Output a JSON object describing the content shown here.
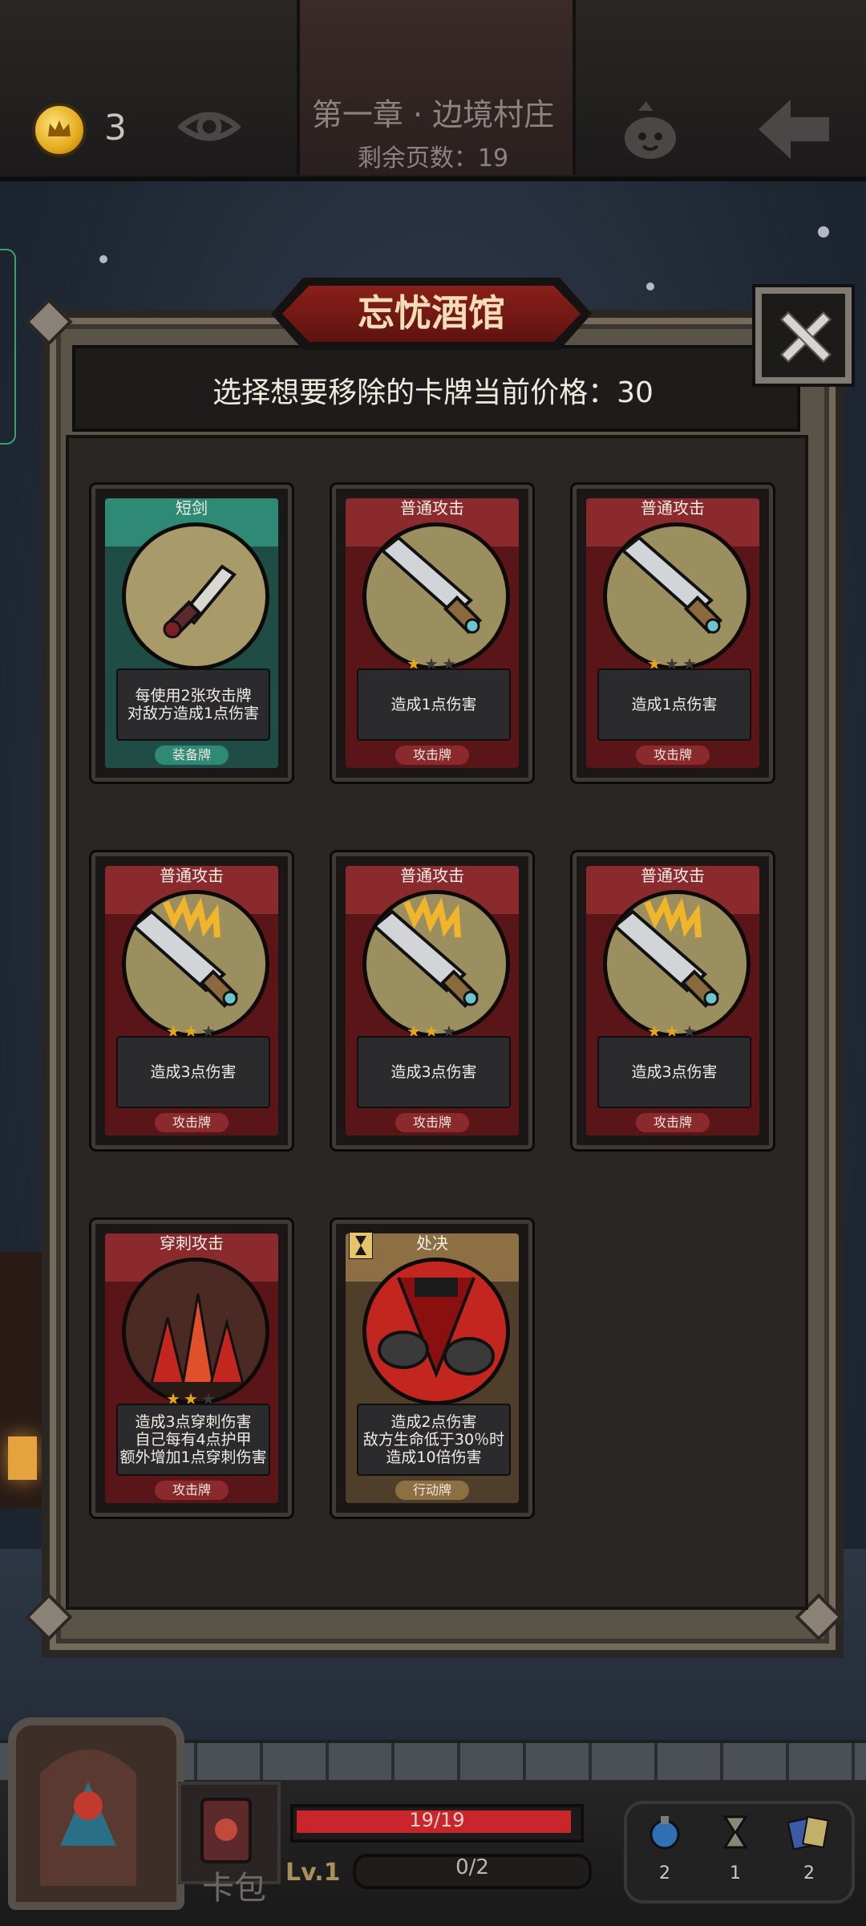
{
  "topbar": {
    "coin_count": "3",
    "chapter_title": "第一章 · 边境村庄",
    "pages_left": "剩余页数：19"
  },
  "dialog": {
    "title": "忘忧酒馆",
    "prompt": "选择想要移除的卡牌当前价格：30"
  },
  "cards": [
    {
      "name": "短剑",
      "desc": [
        "每使用2张攻击牌",
        "对敌方造成1点伤害"
      ],
      "type": "装备牌",
      "theme": "equip",
      "stars": 0,
      "art": "dagger"
    },
    {
      "name": "普通攻击",
      "desc": [
        "造成1点伤害"
      ],
      "type": "攻击牌",
      "theme": "attack",
      "stars": 1,
      "art": "sword"
    },
    {
      "name": "普通攻击",
      "desc": [
        "造成1点伤害"
      ],
      "type": "攻击牌",
      "theme": "attack",
      "stars": 1,
      "art": "sword"
    },
    {
      "name": "普通攻击",
      "desc": [
        "造成3点伤害"
      ],
      "type": "攻击牌",
      "theme": "attack",
      "stars": 2,
      "art": "sword-fire"
    },
    {
      "name": "普通攻击",
      "desc": [
        "造成3点伤害"
      ],
      "type": "攻击牌",
      "theme": "attack",
      "stars": 2,
      "art": "sword-fire"
    },
    {
      "name": "普通攻击",
      "desc": [
        "造成3点伤害"
      ],
      "type": "攻击牌",
      "theme": "attack",
      "stars": 2,
      "art": "sword-fire"
    },
    {
      "name": "穿刺攻击",
      "desc": [
        "造成3点穿刺伤害",
        "自己每有4点护甲",
        "额外增加1点穿刺伤害"
      ],
      "type": "攻击牌",
      "theme": "attack",
      "stars": 2,
      "art": "spikes"
    },
    {
      "name": "处决",
      "desc": [
        "造成2点伤害",
        "敌方生命低于30％时",
        "造成10倍伤害"
      ],
      "type": "行动牌",
      "theme": "action",
      "stars": 0,
      "art": "execute"
    }
  ],
  "hud": {
    "deck_label": "卡包",
    "hp_text": "19/19",
    "hp_current": 19,
    "hp_max": 19,
    "level_text": "Lv.1",
    "exp_text": "0/2",
    "items": [
      {
        "icon": "potion-icon",
        "count": "2"
      },
      {
        "icon": "hourglass-icon",
        "count": "1"
      },
      {
        "icon": "cards-icon",
        "count": "2"
      }
    ]
  },
  "colors": {
    "attack": "#7a1f23",
    "equip": "#2a7a66",
    "action": "#8b6a3f",
    "gold": "#e3a81a"
  }
}
